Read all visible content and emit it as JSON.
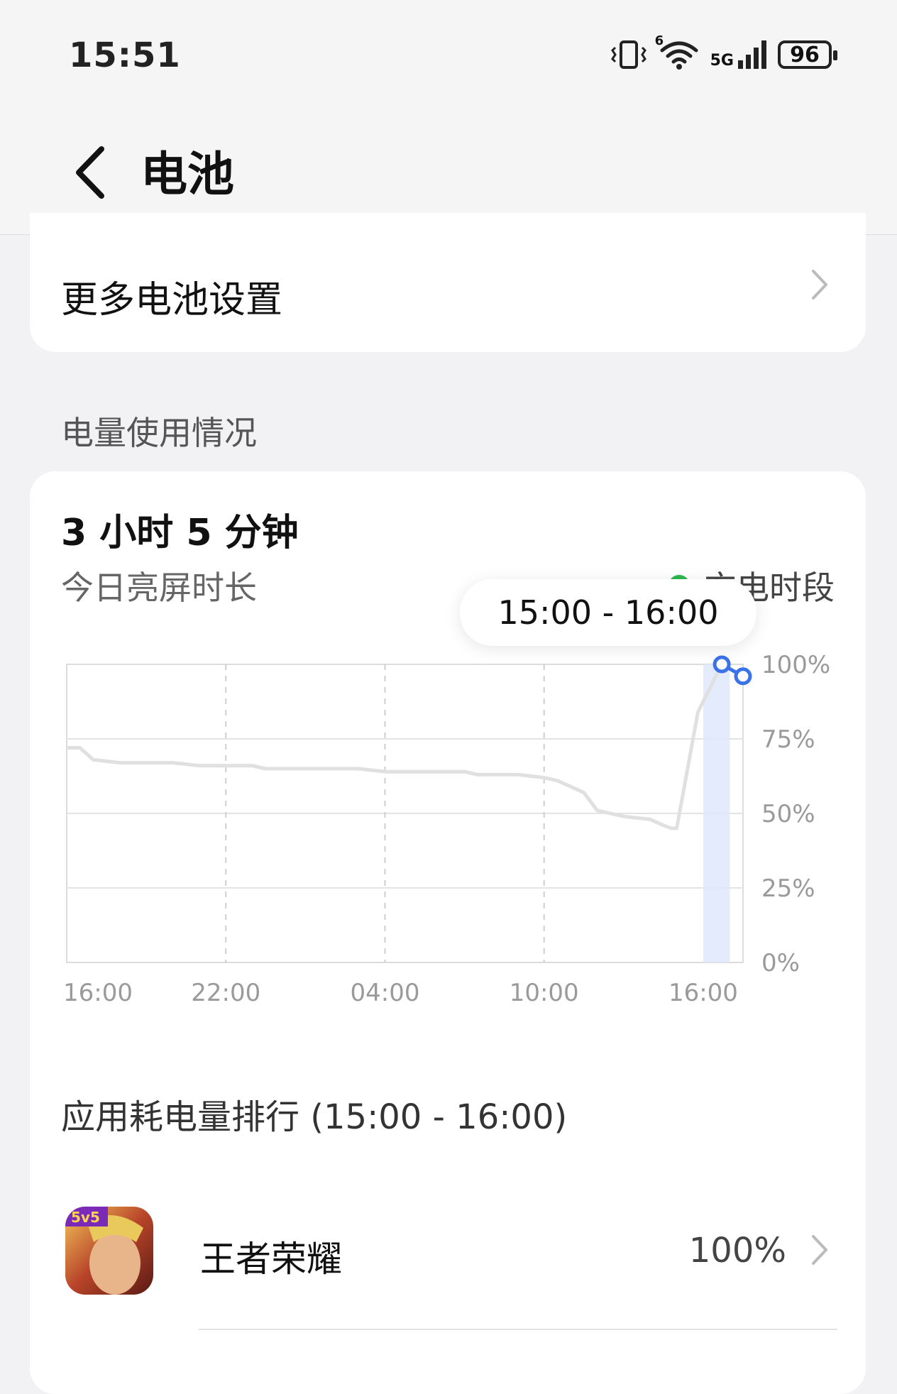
{
  "status_bar": {
    "time": "15:51",
    "wifi_badge": "6",
    "network": "5G",
    "battery_level": "96",
    "icons": [
      "vibrate-icon",
      "wifi-icon",
      "cellular-signal-icon",
      "battery-icon"
    ]
  },
  "header": {
    "title": "电池",
    "back_icon": "chevron-left-icon"
  },
  "settings_card": {
    "label": "更多电池设置"
  },
  "usage_section": {
    "heading": "电量使用情况",
    "screen_time": "3 小时 5 分钟",
    "screen_time_label": "今日亮屏时长",
    "legend_label": "充电时段",
    "legend_color": "#2db84d",
    "tooltip": "15:00 - 16:00"
  },
  "chart_data": {
    "type": "line",
    "x_tick_labels": [
      "16:00",
      "22:00",
      "04:00",
      "10:00",
      "16:00"
    ],
    "y_tick_labels": [
      "100%",
      "75%",
      "50%",
      "25%",
      "0%"
    ],
    "ylim": [
      0,
      100
    ],
    "x_hours": [
      0,
      0.5,
      1,
      2,
      4,
      5,
      6,
      7,
      7.5,
      8,
      11,
      12,
      12.5,
      15,
      15.5,
      16,
      17,
      18,
      18.5,
      19.5,
      20,
      21,
      22,
      22.5,
      22.8,
      23,
      23.8,
      24.7,
      25.5
    ],
    "battery_percent": [
      72,
      72,
      68,
      67,
      67,
      66,
      66,
      66,
      65,
      65,
      65,
      64,
      64,
      64,
      63,
      63,
      63,
      62,
      61,
      57,
      51,
      49,
      48,
      46,
      45,
      45,
      84,
      100,
      96
    ],
    "series_color": "#e0e0e0",
    "selected_range_hours": [
      24.0,
      25.0
    ],
    "selected_color": "#3a72e8",
    "grid": true
  },
  "ranking": {
    "heading": "应用耗电量排行 (15:00 - 16:00)",
    "apps": [
      {
        "name": "王者荣耀",
        "percent": "100%",
        "icon_badge": "5v5"
      }
    ]
  }
}
